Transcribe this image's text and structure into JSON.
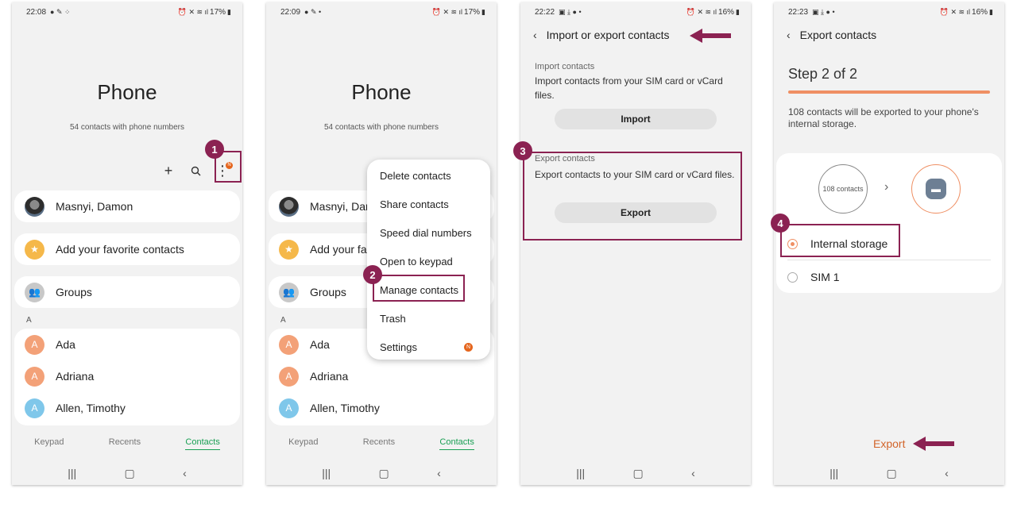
{
  "colors": {
    "accent": "#8b2252",
    "green": "#1a9f54",
    "orange": "#e5651d"
  },
  "steps": [
    "1",
    "2",
    "3",
    "4"
  ],
  "screen1": {
    "status": {
      "time": "22:08",
      "battery": "17%"
    },
    "title": "Phone",
    "subtitle": "54 contacts with phone numbers",
    "icons": {
      "add": "plus-icon",
      "search": "search-icon",
      "more": "more-vert-icon"
    },
    "notif": "N",
    "contacts_top": [
      "Masnyi, Damon",
      "Add your favorite contacts",
      "Groups"
    ],
    "section": "A",
    "contacts": [
      "Ada",
      "Adriana",
      "Allen, Timothy"
    ],
    "initial": "A",
    "tabs": [
      "Keypad",
      "Recents",
      "Contacts"
    ]
  },
  "screen2": {
    "status": {
      "time": "22:09",
      "battery": "17%"
    },
    "title": "Phone",
    "subtitle": "54 contacts with phone numbers",
    "contacts_top": [
      "Masnyi, Dar",
      "Add your fa",
      "Groups"
    ],
    "section": "A",
    "contacts": [
      "Ada",
      "Adriana",
      "Allen, Timothy"
    ],
    "initial": "A",
    "menu": [
      "Delete contacts",
      "Share contacts",
      "Speed dial numbers",
      "Open to keypad",
      "Manage contacts",
      "Trash",
      "Settings"
    ],
    "notif": "N",
    "tabs": [
      "Keypad",
      "Recents",
      "Contacts"
    ]
  },
  "screen3": {
    "status": {
      "time": "22:22",
      "battery": "16%"
    },
    "title": "Import or export contacts",
    "import_label": "Import contacts",
    "import_desc": "Import contacts from your SIM card or vCard files.",
    "import_btn": "Import",
    "export_label": "Export contacts",
    "export_desc": "Export contacts to your SIM card or vCard files.",
    "export_btn": "Export"
  },
  "screen4": {
    "status": {
      "time": "22:23",
      "battery": "16%"
    },
    "title": "Export contacts",
    "step": "Step 2 of 2",
    "desc": "108 contacts will be exported to your phone's internal storage.",
    "circle_text": "108 contacts",
    "options": [
      "Internal storage",
      "SIM 1"
    ],
    "selected": "Internal storage",
    "export_btn": "Export"
  }
}
